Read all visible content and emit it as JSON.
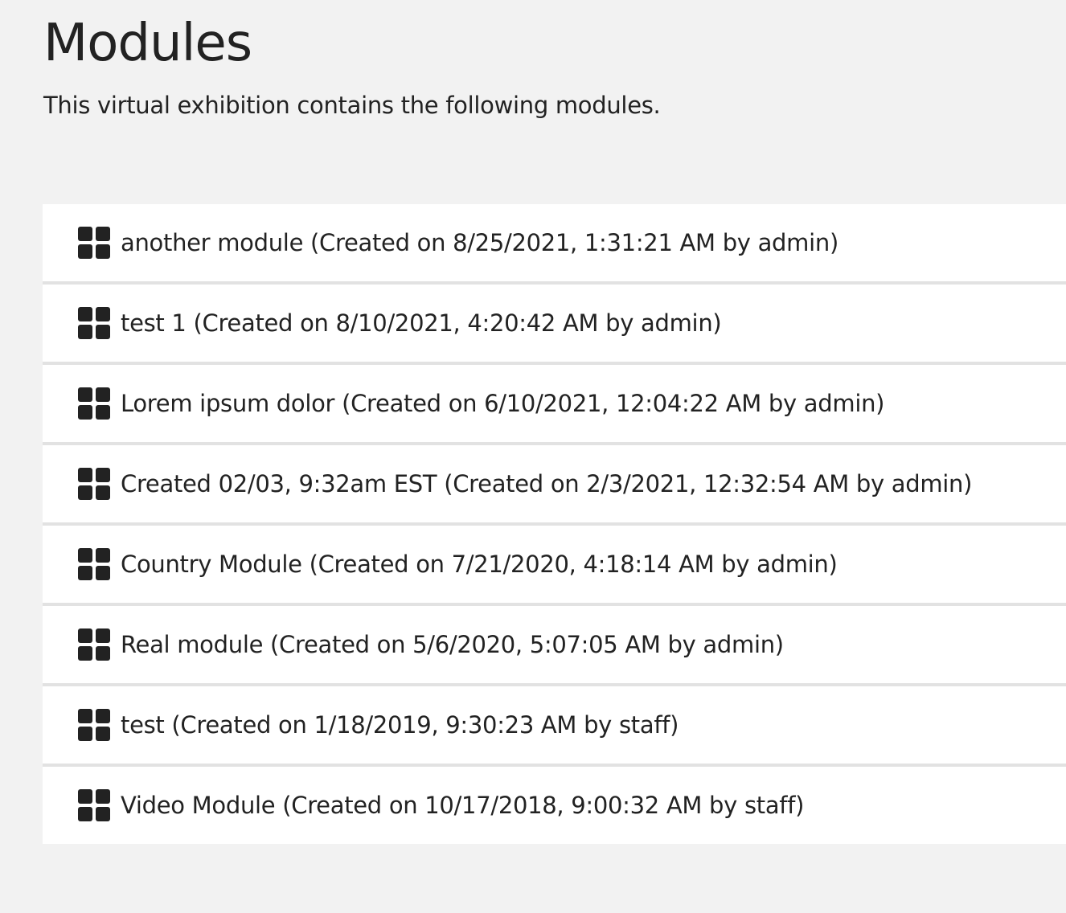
{
  "header": {
    "title": "Modules",
    "subtitle": "This virtual exhibition contains the following modules."
  },
  "modules": [
    {
      "label": "another module (Created on 8/25/2021, 1:31:21 AM by admin)",
      "icon": "grid-icon"
    },
    {
      "label": "test 1 (Created on 8/10/2021, 4:20:42 AM by admin)",
      "icon": "grid-icon"
    },
    {
      "label": "Lorem ipsum dolor (Created on 6/10/2021, 12:04:22 AM by admin)",
      "icon": "grid-icon"
    },
    {
      "label": "Created 02/03, 9:32am EST (Created on 2/3/2021, 12:32:54 AM by admin)",
      "icon": "grid-icon"
    },
    {
      "label": "Country Module (Created on 7/21/2020, 4:18:14 AM by admin)",
      "icon": "grid-icon"
    },
    {
      "label": "Real module (Created on 5/6/2020, 5:07:05 AM by admin)",
      "icon": "grid-icon"
    },
    {
      "label": "test (Created on 1/18/2019, 9:30:23 AM by staff)",
      "icon": "grid-icon"
    },
    {
      "label": "Video Module (Created on 10/17/2018, 9:00:32 AM by staff)",
      "icon": "grid-icon"
    }
  ],
  "colors": {
    "background": "#f2f2f2",
    "row_background": "#ffffff",
    "row_divider": "#e2e2e2",
    "text": "#222222",
    "icon": "#222222"
  }
}
